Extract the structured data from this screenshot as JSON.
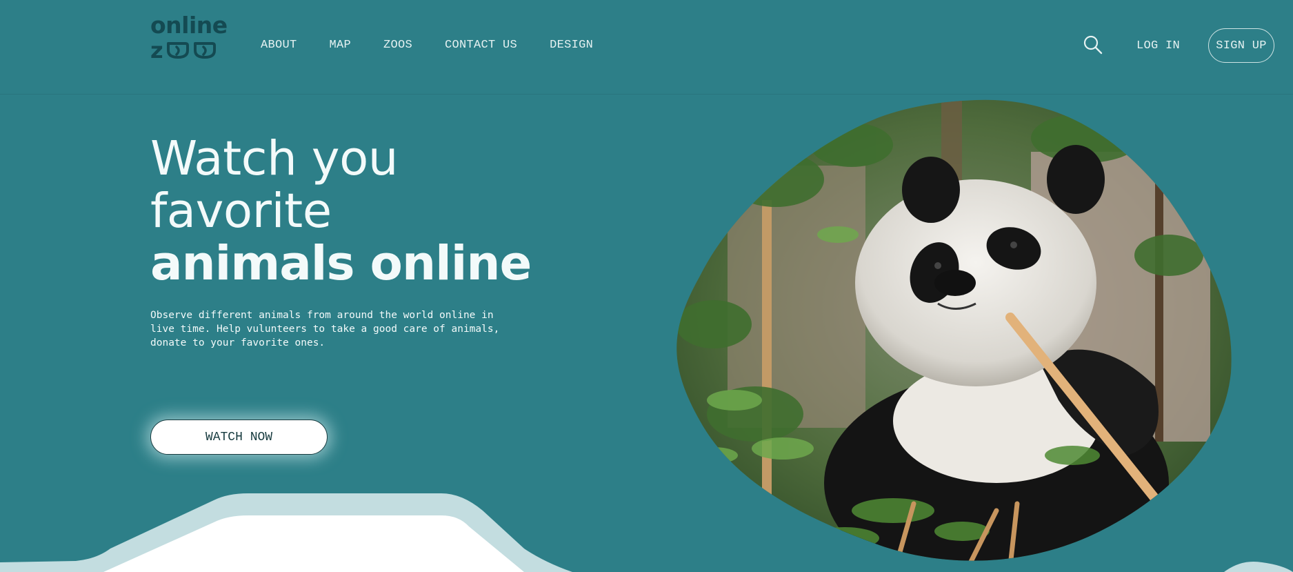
{
  "header": {
    "logo": {
      "line1": "online",
      "line2_letter": "z"
    },
    "nav": [
      {
        "label": "ABOUT"
      },
      {
        "label": "MAP"
      },
      {
        "label": "ZOOS"
      },
      {
        "label": "CONTACT US"
      },
      {
        "label": "DESIGN"
      }
    ],
    "login_label": "LOG IN",
    "signup_label": "SIGN UP",
    "search_icon": "search-icon"
  },
  "hero": {
    "title_line1": "Watch you",
    "title_line2": "favorite",
    "title_line3": "animals online",
    "description": "Observe different animals from around the world online in live time. Help vulunteers to take a good care of animals, donate to your favorite ones.",
    "button_label": "WATCH NOW"
  },
  "colors": {
    "background": "#2d7f88",
    "logo": "#144a52",
    "text": "#f3fafa",
    "wave_light": "#c3dde0",
    "white": "#ffffff"
  }
}
